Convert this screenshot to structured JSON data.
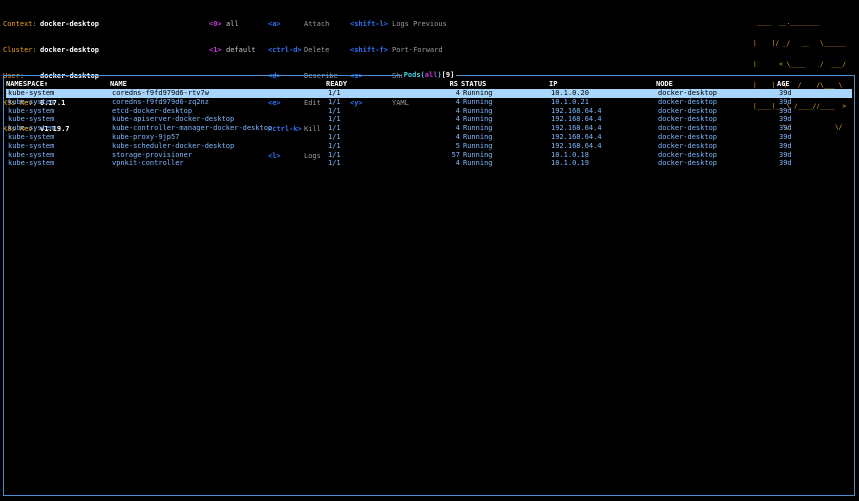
{
  "info": [
    {
      "label": "Context:",
      "value": "docker-desktop"
    },
    {
      "label": "Cluster:",
      "value": "docker-desktop"
    },
    {
      "label": "User:",
      "value": "docker-desktop"
    },
    {
      "label": "K9s Rev:",
      "value": "0.17.1"
    },
    {
      "label": "K8s Rev:",
      "value": "v1.19.7"
    }
  ],
  "namespaces": [
    {
      "key": "<0>",
      "name": "all"
    },
    {
      "key": "<1>",
      "name": "default"
    }
  ],
  "shortcuts_col1": [
    {
      "key": "<a>",
      "cmd": "Attach"
    },
    {
      "key": "<ctrl-d>",
      "cmd": "Delete"
    },
    {
      "key": "<d>",
      "cmd": "Describe"
    },
    {
      "key": "<e>",
      "cmd": "Edit"
    },
    {
      "key": "<ctrl-k>",
      "cmd": "Kill"
    },
    {
      "key": "<l>",
      "cmd": "Logs"
    }
  ],
  "shortcuts_col2": [
    {
      "key": "<shift-l>",
      "cmd": "Logs Previous"
    },
    {
      "key": "<shift-f>",
      "cmd": "Port-Forward"
    },
    {
      "key": "<s>",
      "cmd": "Shell"
    },
    {
      "key": "<y>",
      "cmd": "YAML"
    }
  ],
  "logo_lines": [
    " ____  __.________       ",
    "|    |/ _/   __   \\______",
    "|      < \\____    /  ___/",
    "|    |  \\   /    /\\___ \\ ",
    "|____|__ \\ /____//____  >",
    "        \\/            \\/ "
  ],
  "table": {
    "title_resource": "Pods(",
    "title_ns": "all",
    "title_close": ")",
    "title_count": "[9]",
    "headers": {
      "namespace": "NAMESPACE↑",
      "name": "NAME",
      "ready": "READY",
      "rs": "RS",
      "status": "STATUS",
      "ip": "IP",
      "node": "NODE",
      "age": "AGE"
    },
    "rows": [
      {
        "namespace": "kube-system",
        "name": "coredns-f9fd979d6-rtv7w",
        "ready": "1/1",
        "rs": "4",
        "status": "Running",
        "ip": "10.1.0.20",
        "node": "docker-desktop",
        "age": "39d"
      },
      {
        "namespace": "kube-system",
        "name": "coredns-f9fd979d6-zq2nz",
        "ready": "1/1",
        "rs": "4",
        "status": "Running",
        "ip": "10.1.0.21",
        "node": "docker-desktop",
        "age": "39d"
      },
      {
        "namespace": "kube-system",
        "name": "etcd-docker-desktop",
        "ready": "1/1",
        "rs": "4",
        "status": "Running",
        "ip": "192.168.64.4",
        "node": "docker-desktop",
        "age": "39d"
      },
      {
        "namespace": "kube-system",
        "name": "kube-apiserver-docker-desktop",
        "ready": "1/1",
        "rs": "4",
        "status": "Running",
        "ip": "192.168.64.4",
        "node": "docker-desktop",
        "age": "39d"
      },
      {
        "namespace": "kube-system",
        "name": "kube-controller-manager-docker-desktop",
        "ready": "1/1",
        "rs": "4",
        "status": "Running",
        "ip": "192.168.64.4",
        "node": "docker-desktop",
        "age": "39d"
      },
      {
        "namespace": "kube-system",
        "name": "kube-proxy-9jp57",
        "ready": "1/1",
        "rs": "4",
        "status": "Running",
        "ip": "192.168.64.4",
        "node": "docker-desktop",
        "age": "39d"
      },
      {
        "namespace": "kube-system",
        "name": "kube-scheduler-docker-desktop",
        "ready": "1/1",
        "rs": "5",
        "status": "Running",
        "ip": "192.168.64.4",
        "node": "docker-desktop",
        "age": "39d"
      },
      {
        "namespace": "kube-system",
        "name": "storage-provisioner",
        "ready": "1/1",
        "rs": "57",
        "status": "Running",
        "ip": "10.1.0.18",
        "node": "docker-desktop",
        "age": "39d"
      },
      {
        "namespace": "kube-system",
        "name": "vpnkit-controller",
        "ready": "1/1",
        "rs": "4",
        "status": "Running",
        "ip": "10.1.0.19",
        "node": "docker-desktop",
        "age": "39d"
      }
    ]
  }
}
